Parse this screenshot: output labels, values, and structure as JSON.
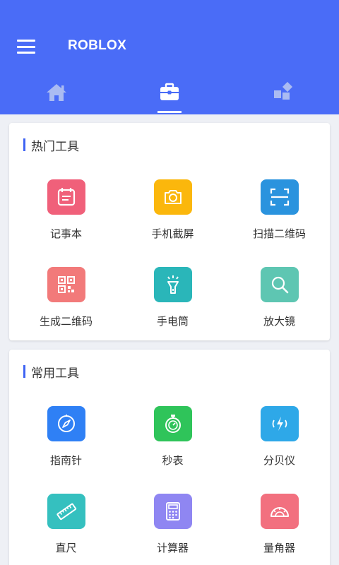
{
  "app": {
    "title": "ROBLOX",
    "menu_icon": "hamburger-menu-icon",
    "colors": {
      "header": "#4a6cf7",
      "accent": "#3f63f3"
    }
  },
  "tabs": [
    {
      "icon": "home-icon",
      "active": false
    },
    {
      "icon": "briefcase-icon",
      "active": true
    },
    {
      "icon": "apps-grid-icon",
      "active": false
    }
  ],
  "sections": {
    "hot": {
      "title": "热门工具",
      "tools": [
        {
          "label": "记事本",
          "icon": "calendar-notes-icon",
          "color": "#f0607a"
        },
        {
          "label": "手机截屏",
          "icon": "camera-icon",
          "color": "#fbb70c"
        },
        {
          "label": "扫描二维码",
          "icon": "scan-frame-icon",
          "color": "#2a93de"
        },
        {
          "label": "生成二维码",
          "icon": "qr-code-icon",
          "color": "#f27a7a"
        },
        {
          "label": "手电筒",
          "icon": "flashlight-icon",
          "color": "#2ab6b9"
        },
        {
          "label": "放大镜",
          "icon": "magnifier-icon",
          "color": "#5ec6b2"
        }
      ]
    },
    "common": {
      "title": "常用工具",
      "tools": [
        {
          "label": "指南针",
          "icon": "compass-icon",
          "color": "#2f80f5"
        },
        {
          "label": "秒表",
          "icon": "stopwatch-icon",
          "color": "#2fc45a"
        },
        {
          "label": "分贝仪",
          "icon": "sound-meter-icon",
          "color": "#2ea8e8"
        },
        {
          "label": "直尺",
          "icon": "ruler-icon",
          "color": "#35c0bf"
        },
        {
          "label": "计算器",
          "icon": "calculator-icon",
          "color": "#8f86f2"
        },
        {
          "label": "量角器",
          "icon": "protractor-icon",
          "color": "#f2707f"
        }
      ]
    }
  }
}
